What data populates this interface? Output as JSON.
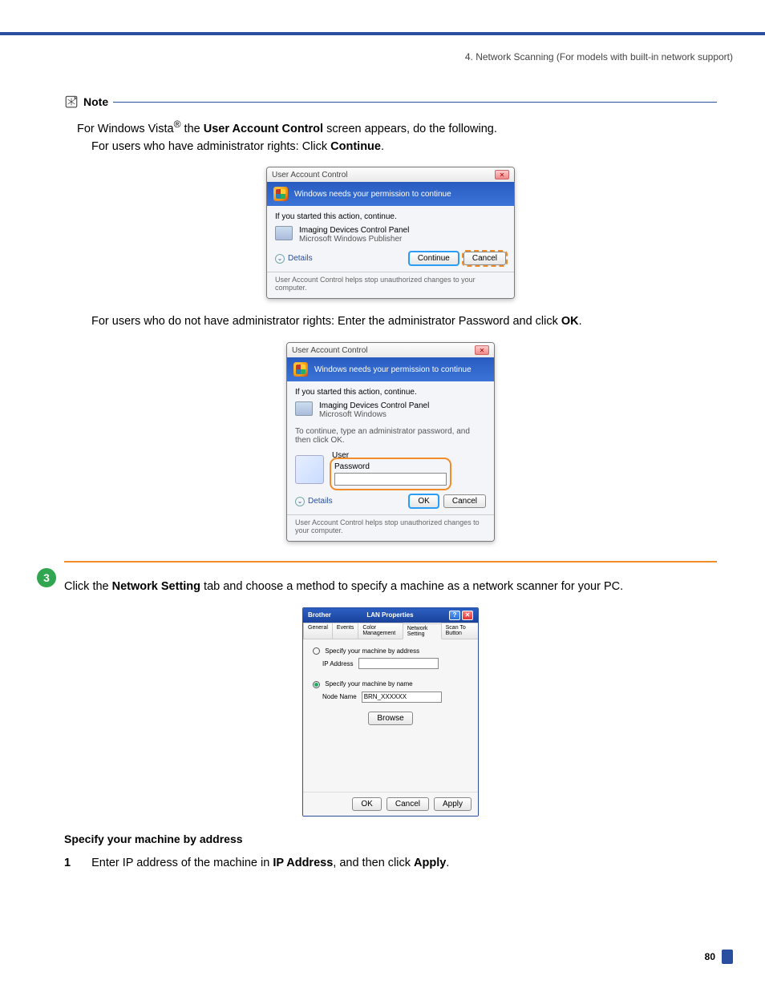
{
  "chapter_ref": "4. Network Scanning (For models with  built-in network support)",
  "note": {
    "label": "Note",
    "line1_pre": "For Windows Vista",
    "line1_post": " the ",
    "line1_bold": "User Account Control",
    "line1_tail": " screen appears, do the following.",
    "bullet_admin_pre": "For users who have administrator rights: Click ",
    "bullet_admin_bold": "Continue",
    "bullet_admin_tail": ".",
    "bullet_nonadmin_pre": "For users who do not have administrator rights: Enter the administrator Password and click ",
    "bullet_nonadmin_bold": "OK",
    "bullet_nonadmin_tail": "."
  },
  "uac1": {
    "title": "User Account Control",
    "banner": "Windows needs your permission to continue",
    "msg": "If you started this action, continue.",
    "program": "Imaging Devices Control Panel",
    "publisher": "Microsoft Windows Publisher",
    "details": "Details",
    "continue": "Continue",
    "cancel": "Cancel",
    "footer": "User Account Control helps stop unauthorized changes to your computer."
  },
  "uac2": {
    "title": "User Account Control",
    "banner": "Windows needs your permission to continue",
    "msg": "If you started this action, continue.",
    "program": "Imaging Devices Control Panel",
    "publisher": "Microsoft Windows",
    "prompt": "To continue, type an administrator password, and then click OK.",
    "user_label": "User",
    "password_label": "Password",
    "details": "Details",
    "ok": "OK",
    "cancel": "Cancel",
    "footer": "User Account Control helps stop unauthorized changes to your computer."
  },
  "step3": {
    "num": "3",
    "text_pre": "Click the ",
    "text_bold": "Network Setting",
    "text_tail": " tab and choose a method to specify a machine as a network scanner for your PC."
  },
  "props": {
    "brand": "Brother",
    "title": "LAN Properties",
    "tabs": {
      "general": "General",
      "events": "Events",
      "color": "Color Management",
      "network": "Network Setting",
      "scan": "Scan To Button"
    },
    "opt_addr": "Specify your machine by address",
    "ip_label": "IP Address",
    "opt_name": "Specify your machine by name",
    "node_label": "Node Name",
    "node_value": "BRN_XXXXXX",
    "browse": "Browse",
    "ok": "OK",
    "cancel": "Cancel",
    "apply": "Apply"
  },
  "spec_addr": {
    "heading": "Specify your machine by address",
    "num": "1",
    "text_pre": "Enter IP address of the machine in ",
    "ip_bold": "IP Address",
    "text_mid": ", and then click ",
    "apply_bold": "Apply",
    "text_tail": "."
  },
  "page_number": "80"
}
